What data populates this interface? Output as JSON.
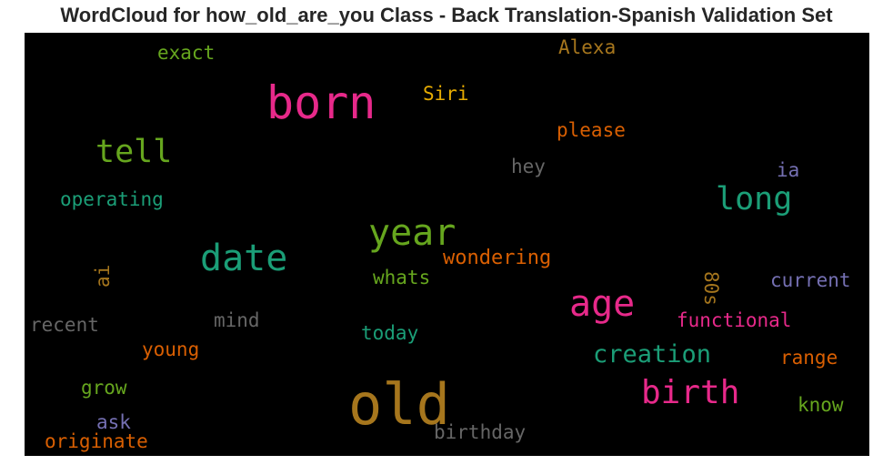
{
  "title": "WordCloud for how_old_are_you Class - Back Translation-Spanish Validation Set",
  "colors": {
    "background": "#000000",
    "pink": "#e7298a",
    "teal": "#1b9e77",
    "green": "#66a61e",
    "orange": "#d95f02",
    "gold": "#a6761d",
    "yellow": "#e6ab02",
    "purple": "#7570b3",
    "gray": "#666666"
  },
  "words": [
    {
      "text": "old"
    },
    {
      "text": "born"
    },
    {
      "text": "year"
    },
    {
      "text": "date"
    },
    {
      "text": "age"
    },
    {
      "text": "birth"
    },
    {
      "text": "tell"
    },
    {
      "text": "long"
    },
    {
      "text": "creation"
    },
    {
      "text": "wondering"
    },
    {
      "text": "functional"
    },
    {
      "text": "please"
    },
    {
      "text": "operating"
    },
    {
      "text": "current"
    },
    {
      "text": "birthday"
    },
    {
      "text": "exact"
    },
    {
      "text": "Alexa"
    },
    {
      "text": "Siri"
    },
    {
      "text": "hey"
    },
    {
      "text": "ia"
    },
    {
      "text": "whats"
    },
    {
      "text": "ai"
    },
    {
      "text": "80s"
    },
    {
      "text": "recent"
    },
    {
      "text": "mind"
    },
    {
      "text": "today"
    },
    {
      "text": "young"
    },
    {
      "text": "range"
    },
    {
      "text": "grow"
    },
    {
      "text": "know"
    },
    {
      "text": "ask"
    },
    {
      "text": "originate"
    }
  ]
}
